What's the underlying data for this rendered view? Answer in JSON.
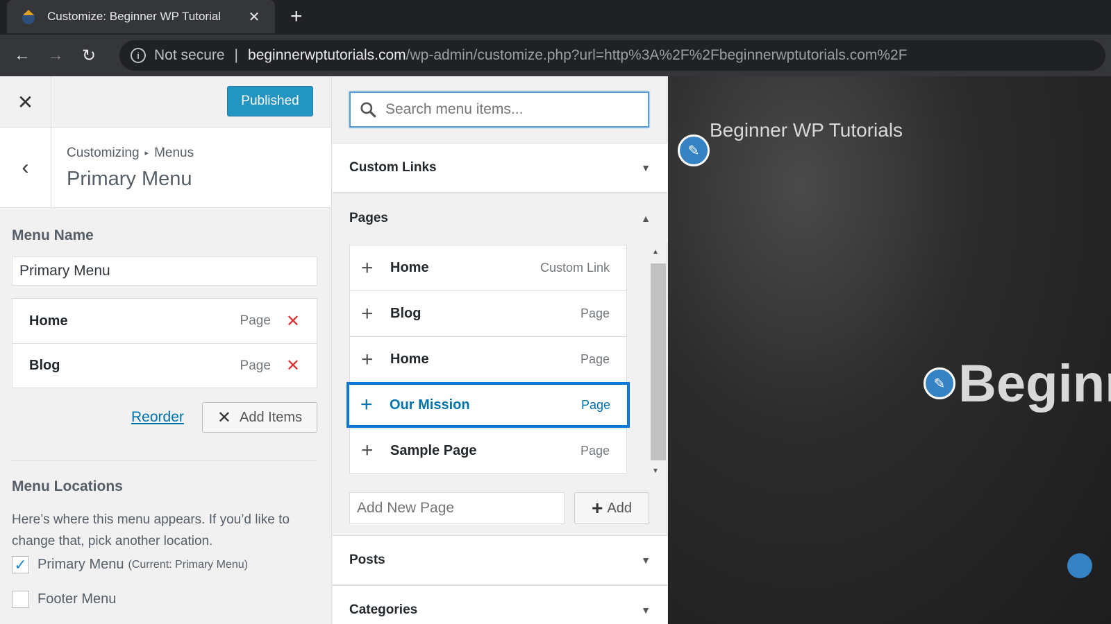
{
  "browser": {
    "tab_title": "Customize: Beginner WP Tutorial",
    "not_secure": "Not secure",
    "url_domain": "beginnerwptutorials.com",
    "url_path": "/wp-admin/customize.php?url=http%3A%2F%2Fbeginnerwptutorials.com%2F"
  },
  "customizer": {
    "publish_label": "Published",
    "breadcrumb_parent": "Customizing",
    "breadcrumb_child": "Menus",
    "section_title": "Primary Menu",
    "menu_name_label": "Menu Name",
    "menu_name_value": "Primary Menu",
    "menu_items": [
      {
        "title": "Home",
        "type": "Page"
      },
      {
        "title": "Blog",
        "type": "Page"
      }
    ],
    "reorder_label": "Reorder",
    "add_items_label": "Add Items",
    "locations_label": "Menu Locations",
    "locations_desc": "Here’s where this menu appears. If you’d like to change that, pick another location.",
    "locations": [
      {
        "label": "Primary Menu",
        "note": "(Current: Primary Menu)",
        "checked": true
      },
      {
        "label": "Footer Menu",
        "note": "",
        "checked": false
      }
    ]
  },
  "available": {
    "search_placeholder": "Search menu items...",
    "sections": {
      "custom_links": "Custom Links",
      "pages": "Pages",
      "posts": "Posts",
      "categories": "Categories"
    },
    "pages": [
      {
        "title": "Home",
        "type": "Custom Link"
      },
      {
        "title": "Blog",
        "type": "Page"
      },
      {
        "title": "Home",
        "type": "Page"
      },
      {
        "title": "Our Mission",
        "type": "Page"
      },
      {
        "title": "Sample Page",
        "type": "Page"
      }
    ],
    "add_new_placeholder": "Add New Page",
    "add_label": "Add"
  },
  "preview": {
    "site_title": "Beginner WP Tutorials",
    "hero_title": "Beginn"
  },
  "colors": {
    "accent": "#0073aa",
    "publish": "#0085ba",
    "delete": "#dc3232",
    "selected_border": "#0d78d4"
  }
}
